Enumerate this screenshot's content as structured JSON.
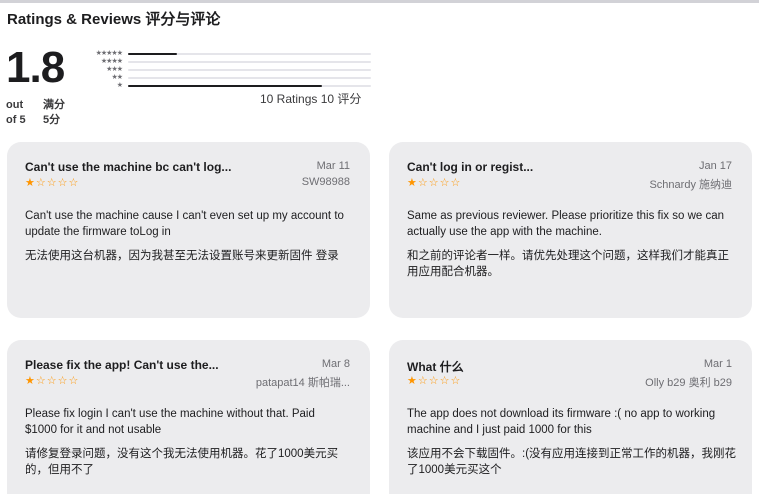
{
  "header": {
    "title": "Ratings & Reviews  评分与评论"
  },
  "summary": {
    "score": "1.8",
    "out_of_en": "out\nof 5",
    "out_of_cn": "满分\n5分",
    "ratings_count": "10 Ratings  10 评分",
    "histogram": [
      {
        "stars": "★★★★★",
        "fraction": 0.2
      },
      {
        "stars": "★★★★",
        "fraction": 0.0
      },
      {
        "stars": "★★★",
        "fraction": 0.0
      },
      {
        "stars": "★★",
        "fraction": 0.0
      },
      {
        "stars": "★",
        "fraction": 0.8
      }
    ]
  },
  "rating_stars": {
    "filled": "★",
    "empty": "☆",
    "star_color": "#ff9500"
  },
  "reviews": [
    {
      "title": "Can't use the machine bc can't log...",
      "date": "Mar 11",
      "author": "SW98988",
      "rating": 1,
      "body_en": "Can't use the machine cause I can't even set up my account to update the firmware toLog in",
      "body_cn": "无法使用这台机器，因为我甚至无法设置账号来更新固件 登录"
    },
    {
      "title": "Can't log in or regist...",
      "date": "Jan 17",
      "author": "Schnardy  施纳迪",
      "rating": 1,
      "body_en": "Same as previous reviewer. Please prioritize this fix so we can actually use the app with the machine.",
      "body_cn": "和之前的评论者一样。请优先处理这个问题，这样我们才能真正用应用配合机器。"
    },
    {
      "title": "Please fix the app! Can't use the...",
      "date": "Mar 8",
      "author": "patapat14  斯帕瑞...",
      "rating": 1,
      "body_en": "Please fix login I can't use the machine without that. Paid $1000 for it and not usable",
      "body_cn": "请修复登录问题，没有这个我无法使用机器。花了1000美元买的，但用不了"
    },
    {
      "title": "What  什么",
      "date": "Mar 1",
      "author": "Olly b29  奥利 b29",
      "rating": 1,
      "body_en": "The app does not download its firmware :( no app to working machine and I just paid 1000 for this",
      "body_cn": "该应用不会下载固件。:(没有应用连接到正常工作的机器，我刚花了1000美元买这个"
    }
  ]
}
